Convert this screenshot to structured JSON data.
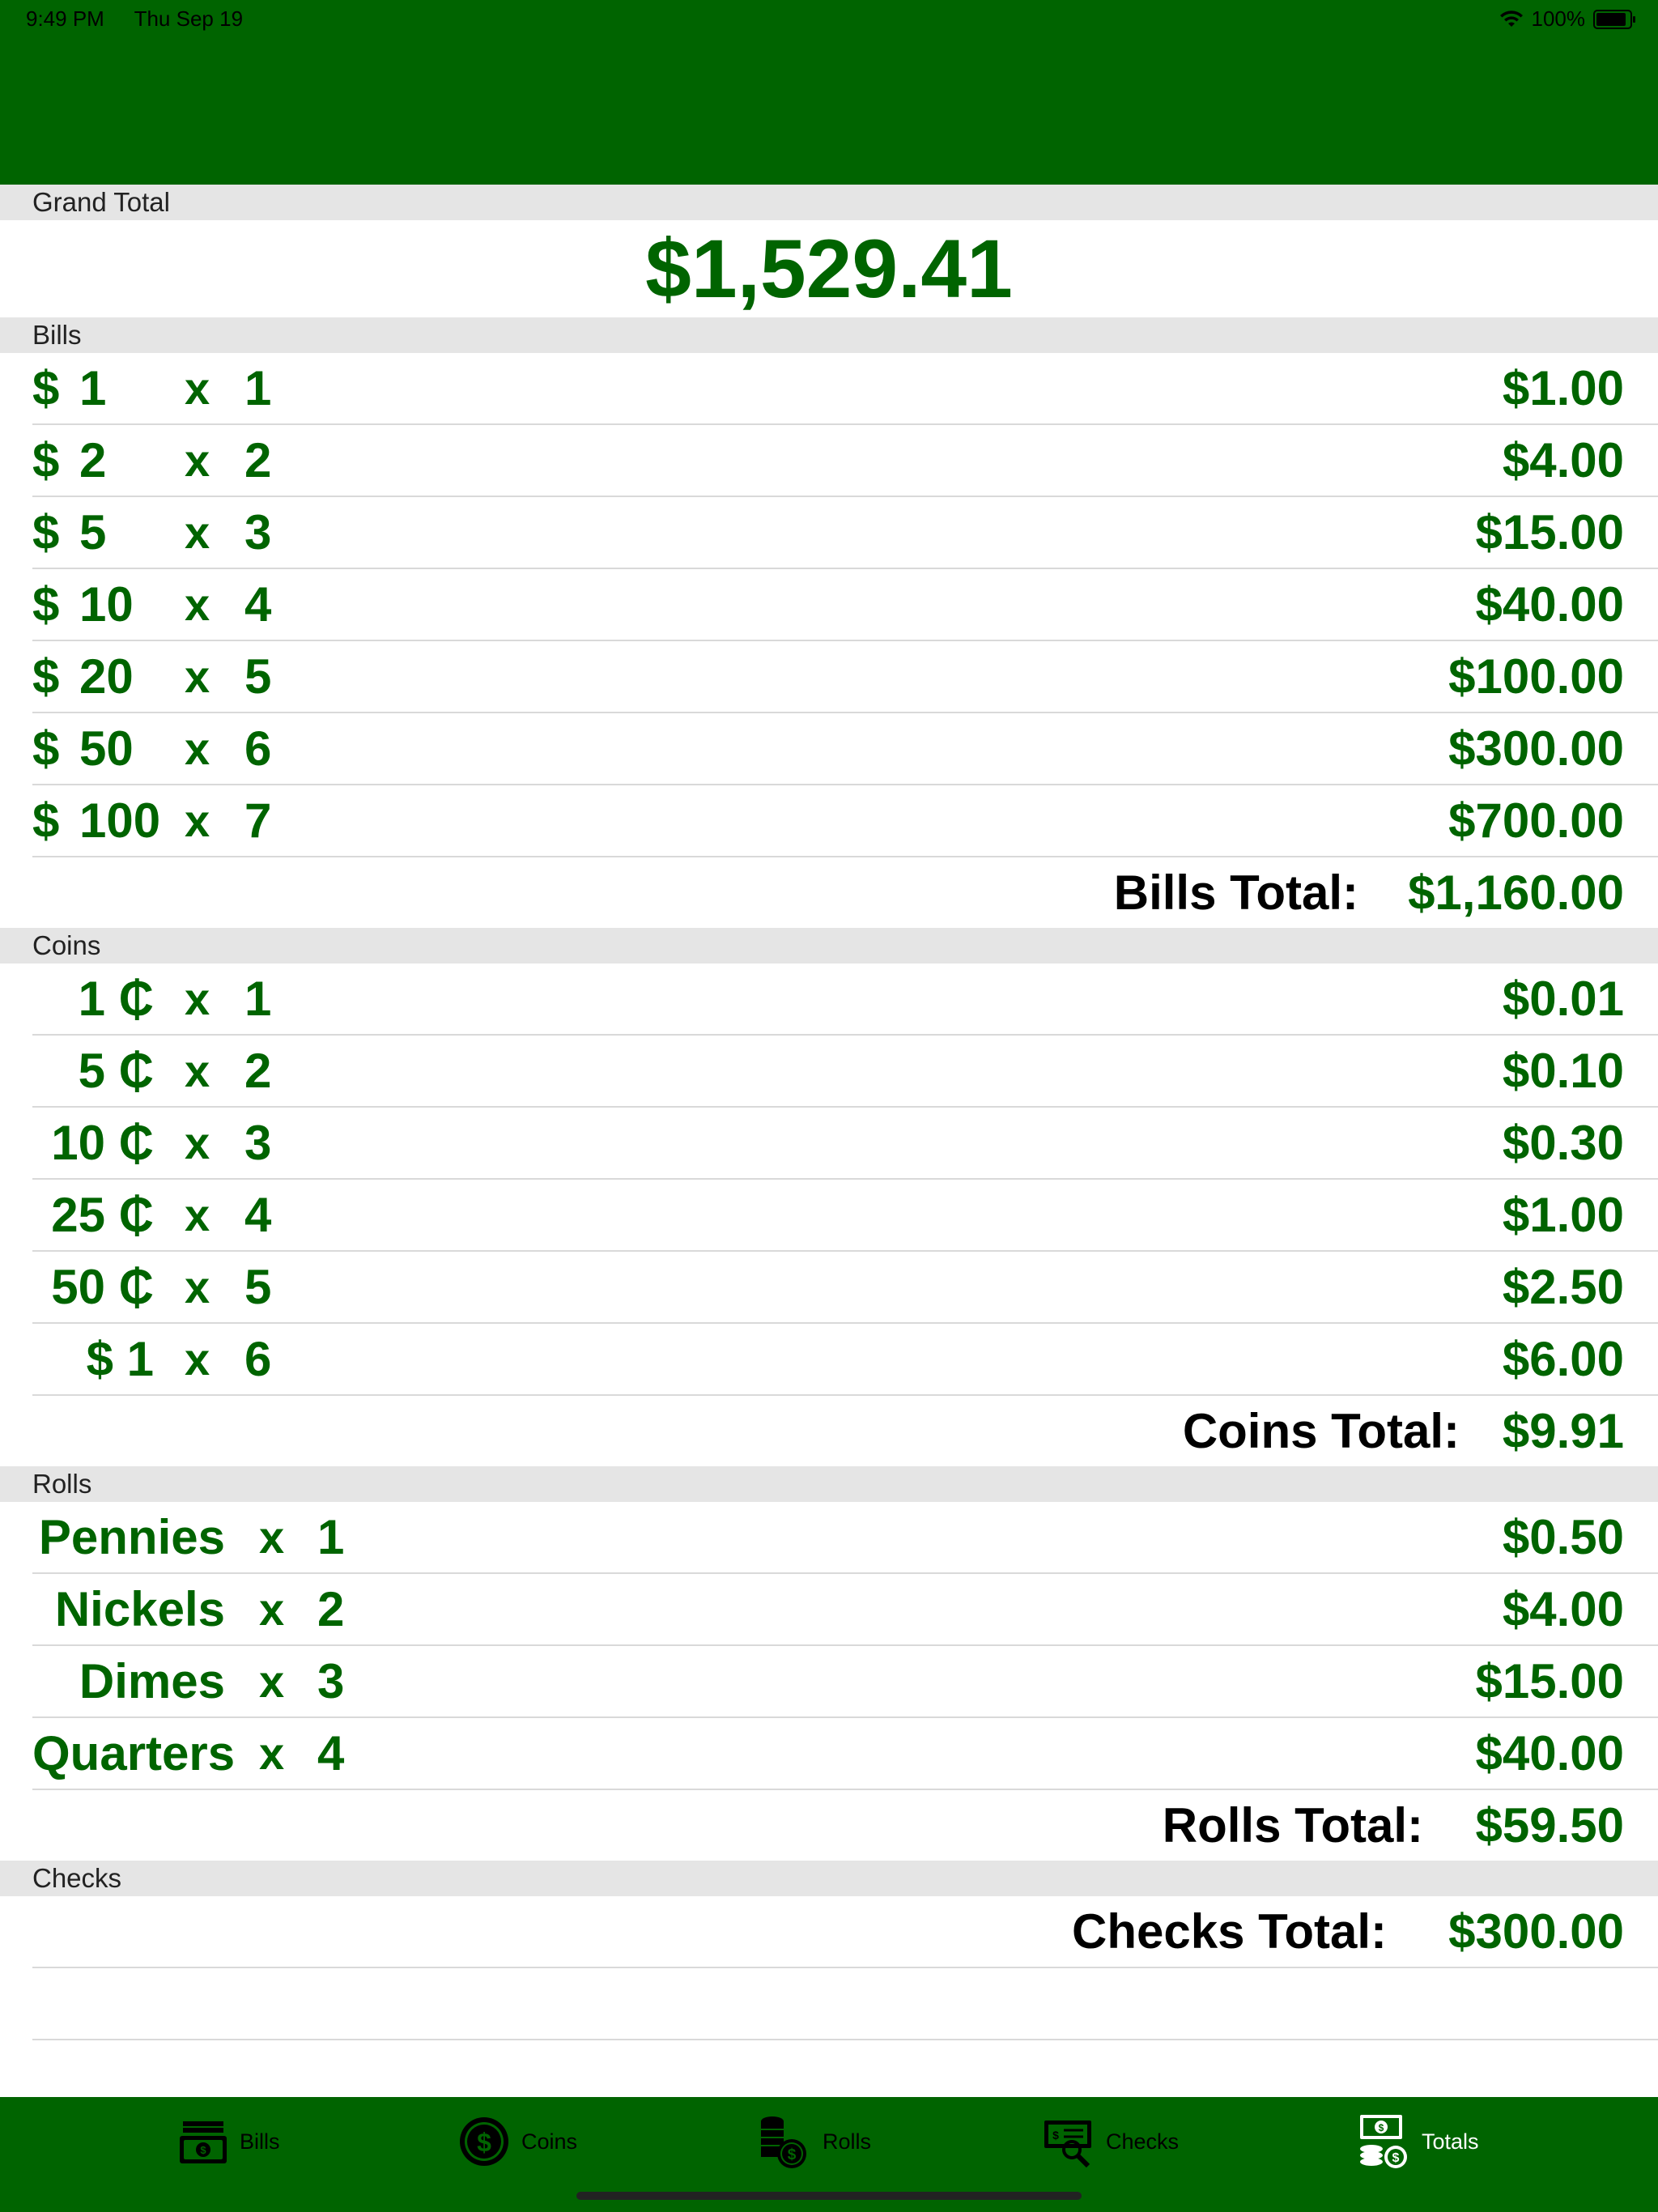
{
  "status": {
    "time": "9:49 PM",
    "date": "Thu Sep 19",
    "battery": "100%",
    "battery_level": 1.0
  },
  "grand_total": {
    "header": "Grand Total",
    "value": "$1,529.41"
  },
  "bills": {
    "header": "Bills",
    "rows": [
      {
        "currency": "$",
        "denom": "1",
        "x": "x",
        "qty": "1",
        "value": "$1.00"
      },
      {
        "currency": "$",
        "denom": "2",
        "x": "x",
        "qty": "2",
        "value": "$4.00"
      },
      {
        "currency": "$",
        "denom": "5",
        "x": "x",
        "qty": "3",
        "value": "$15.00"
      },
      {
        "currency": "$",
        "denom": "10",
        "x": "x",
        "qty": "4",
        "value": "$40.00"
      },
      {
        "currency": "$",
        "denom": "20",
        "x": "x",
        "qty": "5",
        "value": "$100.00"
      },
      {
        "currency": "$",
        "denom": "50",
        "x": "x",
        "qty": "6",
        "value": "$300.00"
      },
      {
        "currency": "$",
        "denom": "100",
        "x": "x",
        "qty": "7",
        "value": "$700.00"
      }
    ],
    "total_label": "Bills Total:",
    "total_value": "$1,160.00"
  },
  "coins": {
    "header": "Coins",
    "rows": [
      {
        "denom": "1 ₵",
        "x": "x",
        "qty": "1",
        "value": "$0.01"
      },
      {
        "denom": "5 ₵",
        "x": "x",
        "qty": "2",
        "value": "$0.10"
      },
      {
        "denom": "10 ₵",
        "x": "x",
        "qty": "3",
        "value": "$0.30"
      },
      {
        "denom": "25 ₵",
        "x": "x",
        "qty": "4",
        "value": "$1.00"
      },
      {
        "denom": "50 ₵",
        "x": "x",
        "qty": "5",
        "value": "$2.50"
      },
      {
        "denom": "$ 1",
        "x": "x",
        "qty": "6",
        "value": "$6.00"
      }
    ],
    "total_label": "Coins Total:",
    "total_value": "$9.91"
  },
  "rolls": {
    "header": "Rolls",
    "rows": [
      {
        "denom": "Pennies",
        "x": "x",
        "qty": "1",
        "value": "$0.50"
      },
      {
        "denom": "Nickels",
        "x": "x",
        "qty": "2",
        "value": "$4.00"
      },
      {
        "denom": "Dimes",
        "x": "x",
        "qty": "3",
        "value": "$15.00"
      },
      {
        "denom": "Quarters",
        "x": "x",
        "qty": "4",
        "value": "$40.00"
      }
    ],
    "total_label": "Rolls Total:",
    "total_value": "$59.50"
  },
  "checks": {
    "header": "Checks",
    "total_label": "Checks Total:",
    "total_value": "$300.00"
  },
  "tabs": [
    {
      "label": "Bills",
      "icon": "bills-icon"
    },
    {
      "label": "Coins",
      "icon": "coin-icon"
    },
    {
      "label": "Rolls",
      "icon": "rolls-icon"
    },
    {
      "label": "Checks",
      "icon": "checks-icon"
    },
    {
      "label": "Totals",
      "icon": "totals-icon"
    }
  ],
  "colors": {
    "accent": "#006400",
    "header_bg": "#e5e5e5",
    "selected_tab": "#ffffff",
    "tab_text": "#000000"
  }
}
